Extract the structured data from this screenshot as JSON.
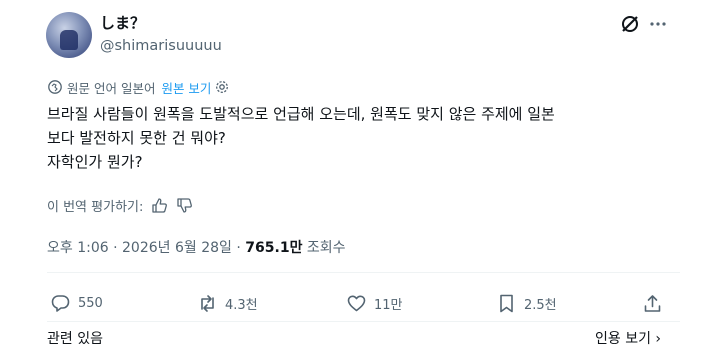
{
  "author": {
    "display_name": "しま？",
    "handle": "@shimarisuuuuu"
  },
  "translation": {
    "source_label": "원문 언어 일본어",
    "show_original_label": "원본 보기"
  },
  "post": {
    "lines": [
      "브라질 사람들이 원폭을 도발적으로 언급해 오는데, 원폭도 맞지 않은 주제에 일본",
      "보다 발전하지 못한 건 뭐야?",
      "자학인가 뭔가?"
    ]
  },
  "rate_translation": {
    "label": "이 번역 평가하기:"
  },
  "meta": {
    "time": "오후 1:06",
    "sep1": " · ",
    "date": "2026년 6월 28일",
    "sep2": " · ",
    "views_count": "765.1만",
    "views_label": " 조회수"
  },
  "actions": {
    "replies": "550",
    "reposts": "4.3천",
    "likes": "11만",
    "bookmarks": "2.5천"
  },
  "footer": {
    "related": "관련 있음",
    "quotes": "인용 보기 ›"
  },
  "colors": {
    "text": "#0f1419",
    "muted": "#536471",
    "accent": "#1d9bf0",
    "divider": "#eff3f4"
  }
}
